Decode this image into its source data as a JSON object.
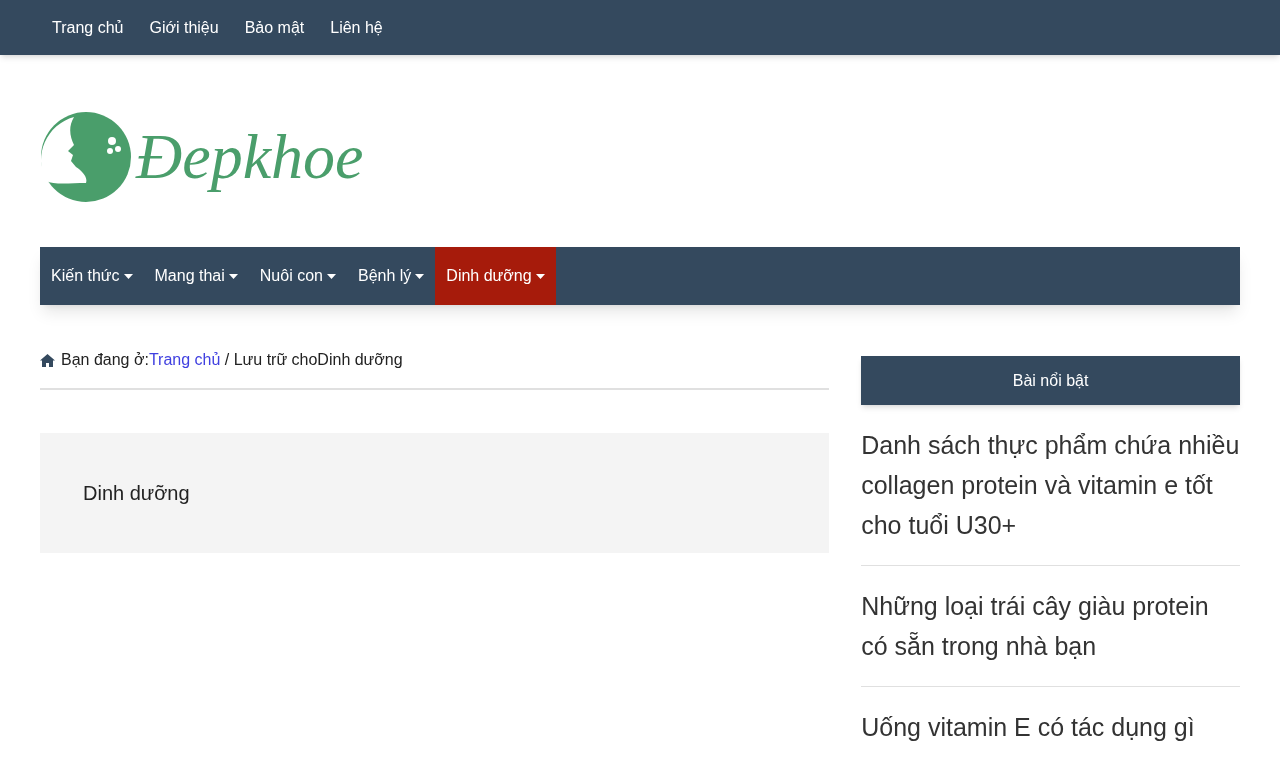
{
  "top_menu": [
    {
      "label": "Trang chủ"
    },
    {
      "label": "Giới thiệu"
    },
    {
      "label": "Bảo mật"
    },
    {
      "label": "Liên hệ"
    }
  ],
  "logo": {
    "text": "Đepkhoe"
  },
  "main_menu": [
    {
      "label": "Kiến thức",
      "selected": false
    },
    {
      "label": "Mang thai",
      "selected": false
    },
    {
      "label": "Nuôi con",
      "selected": false
    },
    {
      "label": "Bệnh lý",
      "selected": false
    },
    {
      "label": "Dinh dưỡng",
      "selected": true
    }
  ],
  "breadcrumb": {
    "prefix": "Bạn đang ở:",
    "link": "Trang chủ",
    "rest": "/ Lưu trữ choDinh dưỡng"
  },
  "archive_title": "Dinh dưỡng",
  "sidebar": {
    "title": "Bài nổi bật",
    "posts": [
      "Danh sách thực phẩm chứa nhiều collagen protein và vitamin e tốt cho tuổi U30+",
      "Những loại trái cây giàu protein có sẵn trong nhà bạn",
      "Uống vitamin E có tác dụng gì"
    ]
  }
}
